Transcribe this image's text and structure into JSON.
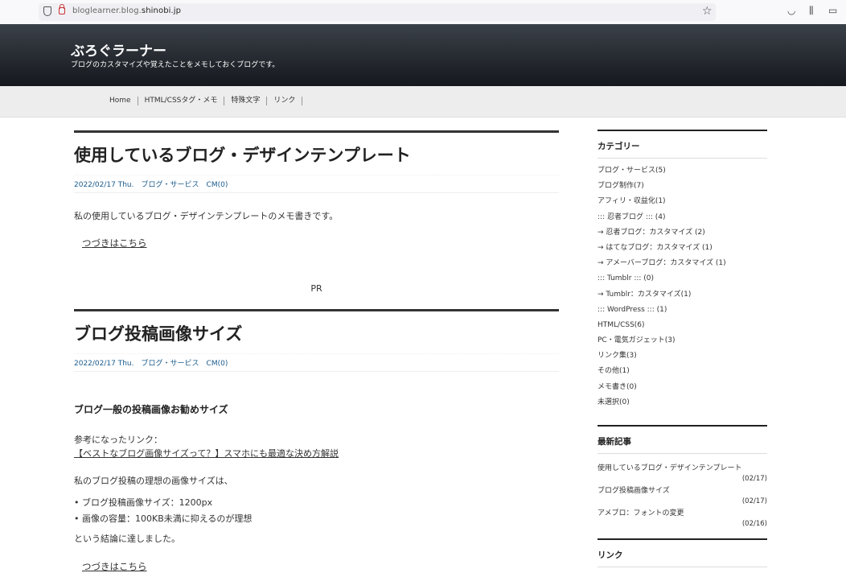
{
  "browser": {
    "url_prefix": "bloglearner.blog.",
    "url_domain": "shinobi.jp"
  },
  "site": {
    "title": "ぶろぐラーナー",
    "description": "ブログのカスタマイズや覚えたことをメモしておくブログです。"
  },
  "nav": [
    "Home",
    "HTML/CSSタグ・メモ",
    "特殊文字",
    "リンク"
  ],
  "articles": [
    {
      "title": "使用しているブログ・デザインテンプレート",
      "date": "2022/02/17 Thu.",
      "category": "ブログ・サービス",
      "comments": "CM(0)",
      "body": "私の使用しているブログ・デザインテンプレートのメモ書きです。",
      "more": "つづきはこちら"
    },
    {
      "title": "ブログ投稿画像サイズ",
      "date": "2022/02/17 Thu.",
      "category": "ブログ・サービス",
      "comments": "CM(0)",
      "subheading": "ブログ一般の投稿画像お勧めサイズ",
      "ref_label": "参考になったリンク：",
      "ref_link": "【ベストなブログ画像サイズって？】スマホにも最適な決め方解説",
      "intro": "私のブログ投稿の理想の画像サイズは、",
      "bullets": [
        "ブログ投稿画像サイズ：1200px",
        "画像の容量：100KB未満に抑えるのが理想"
      ],
      "conclusion": "という結論に達しました。",
      "more": "つづきはこちら"
    }
  ],
  "pr": "PR",
  "sidebar": {
    "categories_title": "カテゴリー",
    "categories": [
      "ブログ・サービス(5)",
      "ブログ制作(7)",
      "アフィリ・収益化(1)",
      "::: 忍者ブログ ::: (4)",
      "→ 忍者ブログ：カスタマイズ (2)",
      "→ はてなブログ：カスタマイズ (1)",
      "→ アメーバーブログ：カスタマイズ (1)",
      "::: Tumblr ::: (0)",
      "→ Tumblr：カスタマイズ(1)",
      "::: WordPress ::: (1)",
      "HTML/CSS(6)",
      "PC・電気ガジェット(3)",
      "リンク集(3)",
      "その他(1)",
      "メモ書き(0)",
      "未選択(0)"
    ],
    "recent_title": "最新記事",
    "recent": [
      {
        "title": "使用しているブログ・デザインテンプレート",
        "date": "(02/17)"
      },
      {
        "title": "ブログ投稿画像サイズ",
        "date": "(02/17)"
      },
      {
        "title": "アメブロ：フォントの変更",
        "date": "(02/16)"
      }
    ],
    "links_title": "リンク"
  }
}
